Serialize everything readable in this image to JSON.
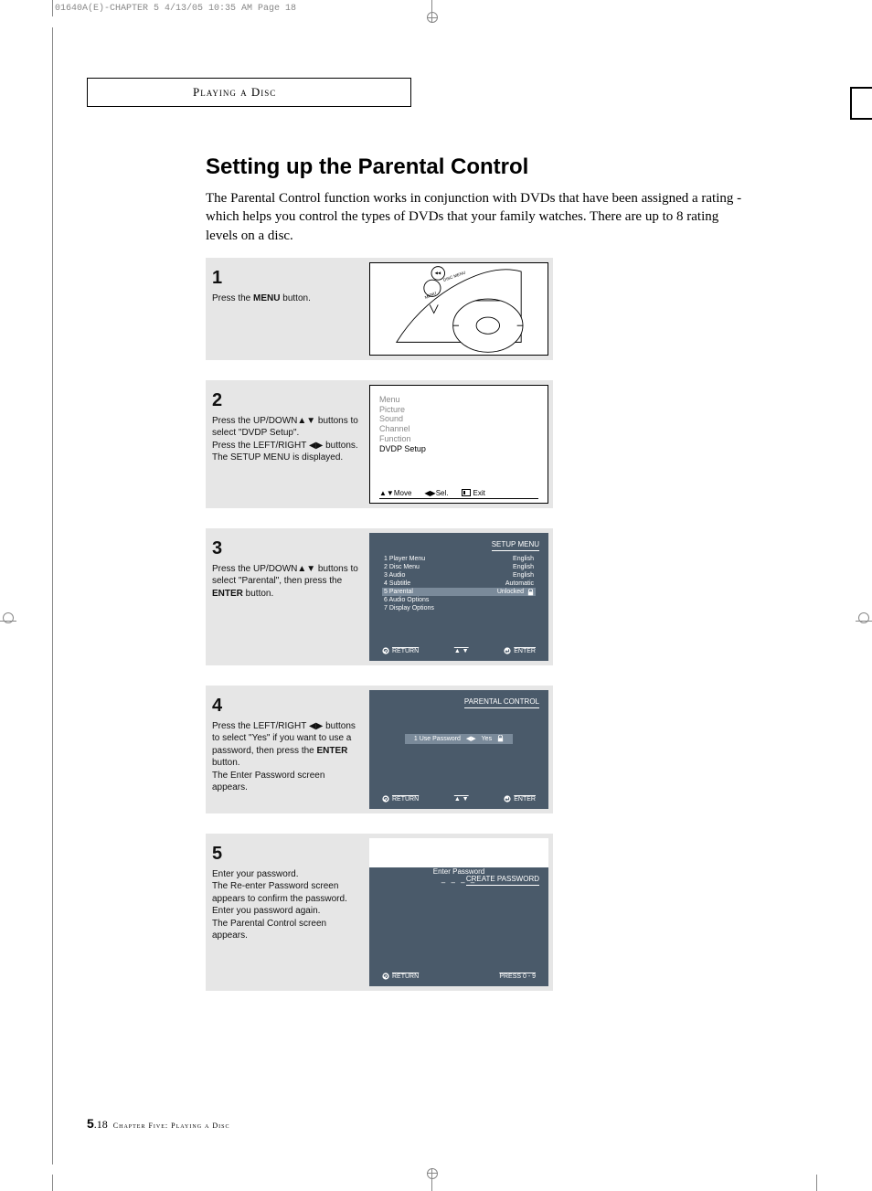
{
  "meta": {
    "header": "01640A(E)-CHAPTER 5  4/13/05  10:35 AM  Page 18"
  },
  "tab": {
    "label": "Playing a Disc"
  },
  "title": "Setting up the Parental Control",
  "intro": "The Parental Control function works in conjunction with DVDs that have been assigned a rating - which helps you control the types of DVDs that your family watches. There are up to 8 rating levels on a disc.",
  "steps": {
    "s1": {
      "num": "1",
      "text_a": "Press the ",
      "text_b": "MENU",
      "text_c": " button.",
      "remote": {
        "label_menu": "MENU",
        "label_disc": "DISC MENU",
        "label_rew": "◂◂"
      }
    },
    "s2": {
      "num": "2",
      "line1": "Press the UP/DOWN▲▼ buttons to select  \"DVDP Setup\".",
      "line2": "Press the LEFT/RIGHT ◀▶ buttons.",
      "line3": "The SETUP MENU is displayed.",
      "menu": [
        "Menu",
        "Picture",
        "Sound",
        "Channel",
        "Function",
        "DVDP Setup"
      ],
      "hints": {
        "move": "▲▼Move",
        "sel": "◀▶Sel.",
        "exit_icon": "⎘",
        "exit": "Exit"
      }
    },
    "s3": {
      "num": "3",
      "line1": "Press the UP/DOWN▲▼ buttons to select \"Parental\", then press the ",
      "line1b": "ENTER",
      "line1c": " button.",
      "tv_title": "SETUP  MENU",
      "rows": [
        {
          "l": "1  Player Menu",
          "r": "English"
        },
        {
          "l": "2  Disc Menu",
          "r": "English"
        },
        {
          "l": "3  Audio",
          "r": "English"
        },
        {
          "l": "4  Subtitle",
          "r": "Automatic"
        },
        {
          "l": "5  Parental",
          "r": "Unlocked",
          "hl": true,
          "lock": true
        },
        {
          "l": "6  Audio Options",
          "r": ""
        },
        {
          "l": "7  Display Options",
          "r": ""
        }
      ],
      "footer": {
        "return": "RETURN",
        "arrows": "▲ ▼",
        "enter": "ENTER"
      }
    },
    "s4": {
      "num": "4",
      "line1": "Press the LEFT/RIGHT ◀▶ buttons to select \"Yes\" if you want to use a password, then press the ",
      "line1b": "ENTER",
      "line1c": " button.",
      "line2": "The Enter Password screen appears.",
      "tv_title": "PARENTAL CONTROL",
      "row_label": "1  Use Password",
      "row_arrows": "◀▶",
      "row_value": "Yes",
      "footer": {
        "return": "RETURN",
        "arrows": "▲ ▼",
        "enter": "ENTER"
      }
    },
    "s5": {
      "num": "5",
      "line1": "Enter your password.",
      "line2": "The Re-enter Password screen appears to confirm the password.",
      "line3": "Enter you password again.",
      "line4": "The Parental Control screen appears.",
      "tv_title": "CREATE PASSWORD",
      "prompt": "Enter Password",
      "dashes": "– – – –",
      "footer": {
        "return": "RETURN",
        "press": "PRESS  0 - 9"
      }
    }
  },
  "footer": {
    "pg_major": "5",
    "pg_minor": ".18",
    "chapter": "Chapter Five: Playing a Disc"
  }
}
